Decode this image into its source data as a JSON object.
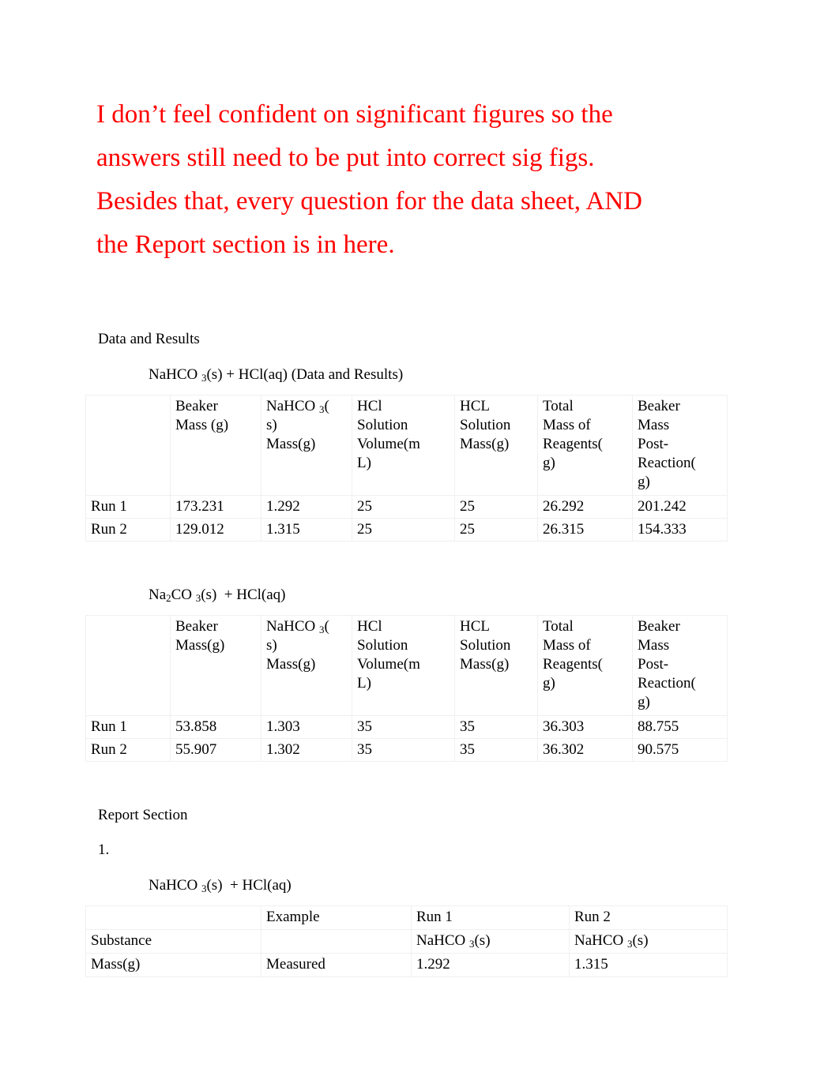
{
  "intro": {
    "text": "I don’t feel confident on significant figures so the answers still need to be put into correct sig figs.       Besides that, every question for the data sheet, AND the Report section is in here.",
    "color": "#FF0000"
  },
  "sections": {
    "data_and_results_label": "Data and Results",
    "report_section_label": "Report Section",
    "list_number": "1."
  },
  "equations": {
    "eq1_pre": "NaHCO ",
    "eq1_sub": "3",
    "eq1_post": "(s) + HCl(aq) (Data and Results)",
    "eq2_pre": "Na",
    "eq2_sub1": "2",
    "eq2_mid": "CO ",
    "eq2_sub2": "3",
    "eq2_post": "(s)  + HCl(aq)",
    "eq3_pre": "NaHCO ",
    "eq3_sub": "3",
    "eq3_post": "(s)  + HCl(aq)"
  },
  "table1": {
    "headers": [
      "",
      "Beaker Mass (g)",
      "NaHCO 3( s) Mass(g)",
      "HCl Solution Volume(m L)",
      "HCL Solution Mass(g)",
      "Total Mass of Reagents( g)",
      "Beaker Mass Post-Reaction( g)"
    ],
    "header_parts": {
      "c1_l1": "Beaker",
      "c1_l2": "Mass (g)",
      "c2_pre": "NaHCO ",
      "c2_sub": "3",
      "c2_after": "(",
      "c2_l2": "s)",
      "c2_l3": "Mass(g)",
      "c3_l1": "HCl",
      "c3_l2": "Solution",
      "c3_l3": "Volume(m",
      "c3_l4": "L)",
      "c4_l1": "HCL",
      "c4_l2": "Solution",
      "c4_l3": "Mass(g)",
      "c5_l1": "Total",
      "c5_l2": "Mass of",
      "c5_l3": "Reagents(",
      "c5_l4": "g)",
      "c6_l1": "Beaker",
      "c6_l2": "Mass",
      "c6_l3": "Post-",
      "c6_l4": "Reaction(",
      "c6_l5": "g)"
    },
    "rows": [
      {
        "label": "Run 1",
        "beaker_mass": "173.231",
        "nahco3_mass": "1.292",
        "hcl_volume": "25",
        "hcl_mass": "25",
        "total_reagents": "26.292",
        "beaker_post": "201.242"
      },
      {
        "label": "Run 2",
        "beaker_mass": "129.012",
        "nahco3_mass": "1.315",
        "hcl_volume": "25",
        "hcl_mass": "25",
        "total_reagents": "26.315",
        "beaker_post": "154.333"
      }
    ]
  },
  "table2": {
    "header_parts": {
      "c1_l1": "Beaker",
      "c1_l2": "Mass(g)",
      "c2_pre": "NaHCO ",
      "c2_sub": "3",
      "c2_after": "(",
      "c2_l2": "s)",
      "c2_l3": "Mass(g)",
      "c3_l1": "HCl",
      "c3_l2": "Solution",
      "c3_l3": "Volume(m",
      "c3_l4": "L)",
      "c4_l1": "HCL",
      "c4_l2": "Solution",
      "c4_l3": "Mass(g)",
      "c5_l1": "Total",
      "c5_l2": "Mass of",
      "c5_l3": "Reagents(",
      "c5_l4": "g)",
      "c6_l1": "Beaker",
      "c6_l2": "Mass",
      "c6_l3": "Post-",
      "c6_l4": "Reaction(",
      "c6_l5": "g)"
    },
    "rows": [
      {
        "label": "Run 1",
        "beaker_mass": "53.858",
        "nahco3_mass": "1.303",
        "hcl_volume": "35",
        "hcl_mass": "35",
        "total_reagents": "36.303",
        "beaker_post": "88.755"
      },
      {
        "label": "Run 2",
        "beaker_mass": "55.907",
        "nahco3_mass": "1.302",
        "hcl_volume": "35",
        "hcl_mass": "35",
        "total_reagents": "36.302",
        "beaker_post": "90.575"
      }
    ]
  },
  "table3": {
    "row1": {
      "c0": "",
      "c1": "Example",
      "c2": "Run 1",
      "c3": "Run 2"
    },
    "row2": {
      "c0": "Substance",
      "c1": "",
      "c2_pre": "NaHCO ",
      "c2_sub": "3",
      "c2_post": "(s)",
      "c3_pre": "NaHCO ",
      "c3_sub": "3",
      "c3_post": "(s)"
    },
    "row3": {
      "c0": "Mass(g)",
      "c1": "Measured",
      "c2": "1.292",
      "c3": "1.315"
    }
  }
}
